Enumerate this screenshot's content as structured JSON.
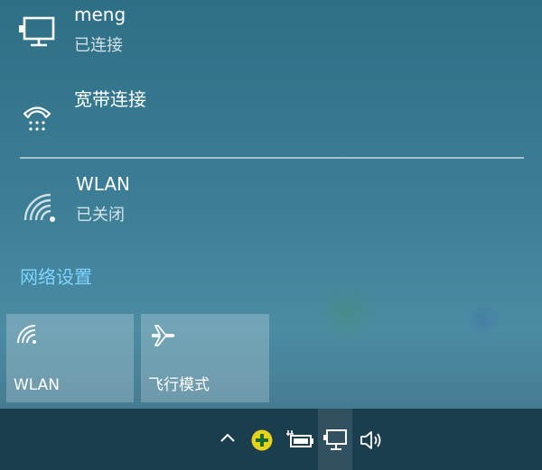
{
  "networks": [
    {
      "name": "meng",
      "status": "已连接",
      "icon": "ethernet-monitor-icon"
    },
    {
      "name": "宽带连接",
      "status": "",
      "icon": "dialup-phone-icon"
    },
    {
      "name": "WLAN",
      "status": "已关闭",
      "icon": "wifi-off-icon"
    }
  ],
  "settings_link": "网络设置",
  "quick_actions": [
    {
      "label": "WLAN",
      "icon": "wifi-icon"
    },
    {
      "label": "飞行模式",
      "icon": "airplane-icon"
    }
  ],
  "taskbar": {
    "icons": [
      "chevron-up-icon",
      "security-plus-icon",
      "battery-plug-icon",
      "network-monitor-icon",
      "volume-icon"
    ]
  },
  "colors": {
    "link": "#7fd3ff",
    "panel": "#3d7f97",
    "taskbar": "#1b3e4f",
    "tile": "#6a9bb0",
    "security_badge": "#e6d21a"
  }
}
